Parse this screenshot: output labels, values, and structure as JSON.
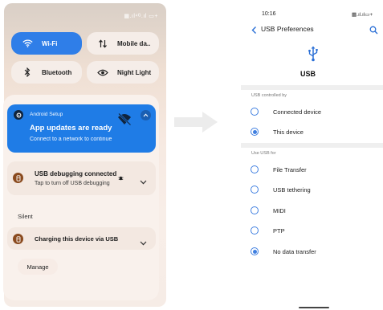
{
  "left_screen": {
    "status_icons": "▦.ıl⁴ᴳ.ıl ▭+",
    "quick_tiles": {
      "wifi": {
        "label": "Wi-Fi",
        "active": true
      },
      "mobile_data": {
        "label": "Mobile da..",
        "active": false
      },
      "bluetooth": {
        "label": "Bluetooth",
        "active": false
      },
      "night_light": {
        "label": "Night Light",
        "active": false
      }
    },
    "setup_notification": {
      "app_name": "Android Setup",
      "title": "App updates are ready",
      "subtitle": "Connect to a network to continue"
    },
    "usb_debug_notification": {
      "title": "USB debugging connected",
      "subtitle": "Tap to turn off USB debugging"
    },
    "silent_section_label": "Silent",
    "charging_notification": {
      "title": "Charging this device via USB"
    },
    "manage_label": "Manage"
  },
  "right_screen": {
    "time": "10:16",
    "status_icons": "▦.ıl.ıl▭+",
    "title": "USB Preferences",
    "usb_heading": "USB",
    "sections": {
      "controlled_by": {
        "label": "USB controlled by",
        "options": [
          {
            "label": "Connected device",
            "selected": false
          },
          {
            "label": "This device",
            "selected": true
          }
        ]
      },
      "use_usb_for": {
        "label": "Use USB for",
        "options": [
          {
            "label": "File Transfer",
            "selected": false
          },
          {
            "label": "USB tethering",
            "selected": false
          },
          {
            "label": "MIDI",
            "selected": false
          },
          {
            "label": "PTP",
            "selected": false
          },
          {
            "label": "No data transfer",
            "selected": true
          }
        ]
      }
    }
  },
  "colors": {
    "accent_blue": "#2f7ee8",
    "notification_blue": "#1f7ce6",
    "radio_blue": "#3f7fe0",
    "usb_icon_blue": "#2a6fd6",
    "notif_icon_brown": "#8a4a1e"
  },
  "icons": [
    "wifi-icon",
    "mobile-data-icon",
    "bluetooth-icon",
    "eye-icon",
    "android-setup-icon",
    "wifi-off-icon",
    "chevron-up-icon",
    "usb-debug-icon",
    "bug-icon",
    "chevron-down-icon",
    "battery-charge-icon",
    "arrow-right-icon",
    "back-arrow-icon",
    "search-icon",
    "usb-icon"
  ]
}
